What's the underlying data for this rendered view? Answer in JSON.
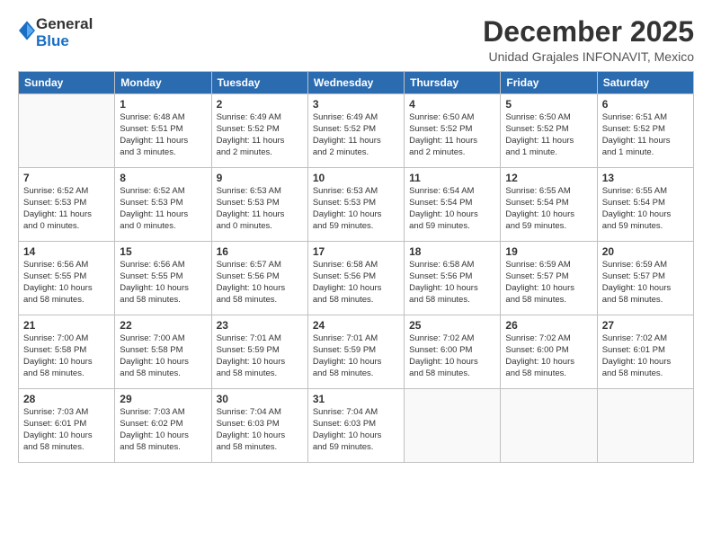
{
  "logo": {
    "line1": "General",
    "line2": "Blue"
  },
  "title": "December 2025",
  "subtitle": "Unidad Grajales INFONAVIT, Mexico",
  "days_header": [
    "Sunday",
    "Monday",
    "Tuesday",
    "Wednesday",
    "Thursday",
    "Friday",
    "Saturday"
  ],
  "weeks": [
    [
      {
        "num": "",
        "info": ""
      },
      {
        "num": "1",
        "info": "Sunrise: 6:48 AM\nSunset: 5:51 PM\nDaylight: 11 hours\nand 3 minutes."
      },
      {
        "num": "2",
        "info": "Sunrise: 6:49 AM\nSunset: 5:52 PM\nDaylight: 11 hours\nand 2 minutes."
      },
      {
        "num": "3",
        "info": "Sunrise: 6:49 AM\nSunset: 5:52 PM\nDaylight: 11 hours\nand 2 minutes."
      },
      {
        "num": "4",
        "info": "Sunrise: 6:50 AM\nSunset: 5:52 PM\nDaylight: 11 hours\nand 2 minutes."
      },
      {
        "num": "5",
        "info": "Sunrise: 6:50 AM\nSunset: 5:52 PM\nDaylight: 11 hours\nand 1 minute."
      },
      {
        "num": "6",
        "info": "Sunrise: 6:51 AM\nSunset: 5:52 PM\nDaylight: 11 hours\nand 1 minute."
      }
    ],
    [
      {
        "num": "7",
        "info": "Sunrise: 6:52 AM\nSunset: 5:53 PM\nDaylight: 11 hours\nand 0 minutes."
      },
      {
        "num": "8",
        "info": "Sunrise: 6:52 AM\nSunset: 5:53 PM\nDaylight: 11 hours\nand 0 minutes."
      },
      {
        "num": "9",
        "info": "Sunrise: 6:53 AM\nSunset: 5:53 PM\nDaylight: 11 hours\nand 0 minutes."
      },
      {
        "num": "10",
        "info": "Sunrise: 6:53 AM\nSunset: 5:53 PM\nDaylight: 10 hours\nand 59 minutes."
      },
      {
        "num": "11",
        "info": "Sunrise: 6:54 AM\nSunset: 5:54 PM\nDaylight: 10 hours\nand 59 minutes."
      },
      {
        "num": "12",
        "info": "Sunrise: 6:55 AM\nSunset: 5:54 PM\nDaylight: 10 hours\nand 59 minutes."
      },
      {
        "num": "13",
        "info": "Sunrise: 6:55 AM\nSunset: 5:54 PM\nDaylight: 10 hours\nand 59 minutes."
      }
    ],
    [
      {
        "num": "14",
        "info": "Sunrise: 6:56 AM\nSunset: 5:55 PM\nDaylight: 10 hours\nand 58 minutes."
      },
      {
        "num": "15",
        "info": "Sunrise: 6:56 AM\nSunset: 5:55 PM\nDaylight: 10 hours\nand 58 minutes."
      },
      {
        "num": "16",
        "info": "Sunrise: 6:57 AM\nSunset: 5:56 PM\nDaylight: 10 hours\nand 58 minutes."
      },
      {
        "num": "17",
        "info": "Sunrise: 6:58 AM\nSunset: 5:56 PM\nDaylight: 10 hours\nand 58 minutes."
      },
      {
        "num": "18",
        "info": "Sunrise: 6:58 AM\nSunset: 5:56 PM\nDaylight: 10 hours\nand 58 minutes."
      },
      {
        "num": "19",
        "info": "Sunrise: 6:59 AM\nSunset: 5:57 PM\nDaylight: 10 hours\nand 58 minutes."
      },
      {
        "num": "20",
        "info": "Sunrise: 6:59 AM\nSunset: 5:57 PM\nDaylight: 10 hours\nand 58 minutes."
      }
    ],
    [
      {
        "num": "21",
        "info": "Sunrise: 7:00 AM\nSunset: 5:58 PM\nDaylight: 10 hours\nand 58 minutes."
      },
      {
        "num": "22",
        "info": "Sunrise: 7:00 AM\nSunset: 5:58 PM\nDaylight: 10 hours\nand 58 minutes."
      },
      {
        "num": "23",
        "info": "Sunrise: 7:01 AM\nSunset: 5:59 PM\nDaylight: 10 hours\nand 58 minutes."
      },
      {
        "num": "24",
        "info": "Sunrise: 7:01 AM\nSunset: 5:59 PM\nDaylight: 10 hours\nand 58 minutes."
      },
      {
        "num": "25",
        "info": "Sunrise: 7:02 AM\nSunset: 6:00 PM\nDaylight: 10 hours\nand 58 minutes."
      },
      {
        "num": "26",
        "info": "Sunrise: 7:02 AM\nSunset: 6:00 PM\nDaylight: 10 hours\nand 58 minutes."
      },
      {
        "num": "27",
        "info": "Sunrise: 7:02 AM\nSunset: 6:01 PM\nDaylight: 10 hours\nand 58 minutes."
      }
    ],
    [
      {
        "num": "28",
        "info": "Sunrise: 7:03 AM\nSunset: 6:01 PM\nDaylight: 10 hours\nand 58 minutes."
      },
      {
        "num": "29",
        "info": "Sunrise: 7:03 AM\nSunset: 6:02 PM\nDaylight: 10 hours\nand 58 minutes."
      },
      {
        "num": "30",
        "info": "Sunrise: 7:04 AM\nSunset: 6:03 PM\nDaylight: 10 hours\nand 58 minutes."
      },
      {
        "num": "31",
        "info": "Sunrise: 7:04 AM\nSunset: 6:03 PM\nDaylight: 10 hours\nand 59 minutes."
      },
      {
        "num": "",
        "info": ""
      },
      {
        "num": "",
        "info": ""
      },
      {
        "num": "",
        "info": ""
      }
    ]
  ]
}
